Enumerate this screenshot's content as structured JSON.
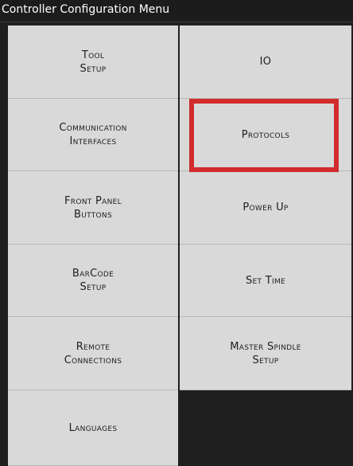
{
  "window": {
    "title": "Controller Configuration Menu"
  },
  "menu": {
    "items": [
      {
        "id": "tool-setup",
        "label": "Tool\nSetup"
      },
      {
        "id": "io",
        "label": "IO"
      },
      {
        "id": "communication-interfaces",
        "label": "Communication\nInterfaces"
      },
      {
        "id": "protocols",
        "label": "Protocols"
      },
      {
        "id": "front-panel-buttons",
        "label": "Front Panel\nButtons"
      },
      {
        "id": "power-up",
        "label": "Power Up"
      },
      {
        "id": "barcode-setup",
        "label": "BarCode\nSetup"
      },
      {
        "id": "set-time",
        "label": "Set Time"
      },
      {
        "id": "remote-connections",
        "label": "Remote\nConnections"
      },
      {
        "id": "master-spindle-setup",
        "label": "Master Spindle\nSetup"
      },
      {
        "id": "languages",
        "label": "Languages"
      }
    ]
  },
  "colors": {
    "tile_background": "#d9d9d9",
    "window_background": "#1f1f1f",
    "highlight_border": "#d12b2b",
    "label_text": "#1e1e1e"
  }
}
